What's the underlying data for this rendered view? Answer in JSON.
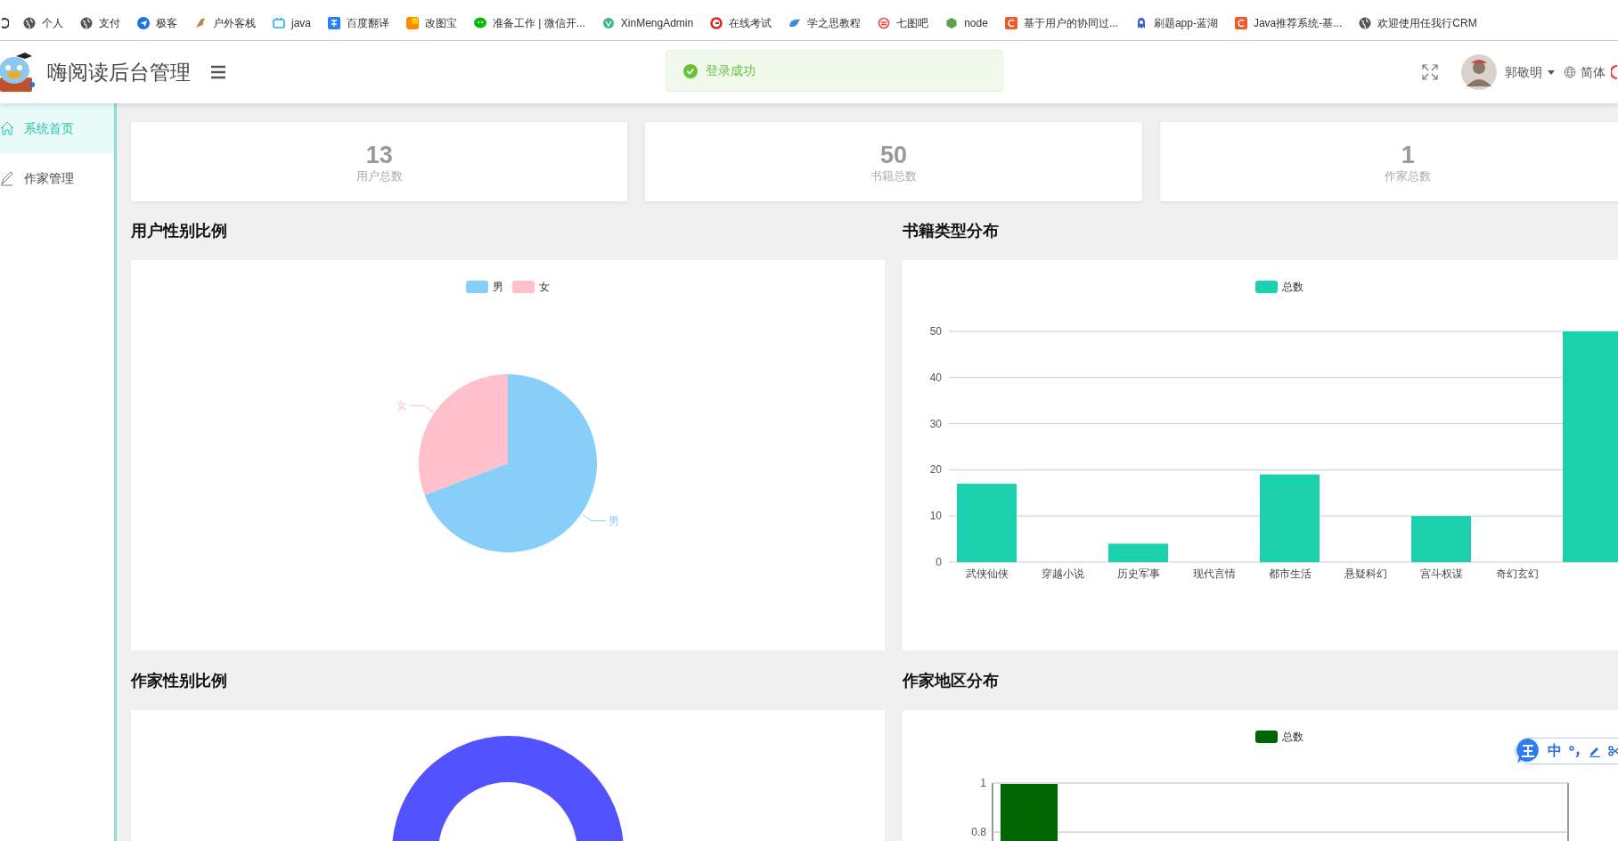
{
  "bookmarks": [
    {
      "label": "个人"
    },
    {
      "label": "支付"
    },
    {
      "label": "极客"
    },
    {
      "label": "户外客栈"
    },
    {
      "label": "java"
    },
    {
      "label": "百度翻译"
    },
    {
      "label": "改图宝"
    },
    {
      "label": "准备工作 | 微信开..."
    },
    {
      "label": "XinMengAdmin"
    },
    {
      "label": "在线考试"
    },
    {
      "label": "学之思教程"
    },
    {
      "label": "七图吧"
    },
    {
      "label": "node"
    },
    {
      "label": "基于用户的协同过..."
    },
    {
      "label": "刷题app-蓝湖"
    },
    {
      "label": "Java推荐系统-基..."
    },
    {
      "label": "欢迎使用任我行CRM"
    }
  ],
  "header": {
    "title": "嗨阅读后台管理",
    "user": "郭敬明",
    "language": "简体"
  },
  "toast": {
    "message": "登录成功"
  },
  "sidebar": {
    "items": [
      {
        "label": "系统首页",
        "selected": true
      },
      {
        "label": "作家管理",
        "selected": false
      }
    ]
  },
  "stats": [
    {
      "value": "13",
      "label": "用户总数"
    },
    {
      "value": "50",
      "label": "书籍总数"
    },
    {
      "value": "1",
      "label": "作家总数"
    }
  ],
  "panels": [
    {
      "title": "用户性别比例",
      "legend": [
        {
          "label": "男",
          "color": "#87cefa"
        },
        {
          "label": "女",
          "color": "#ffc0cb"
        }
      ],
      "chart_data": {
        "type": "pie",
        "categories": [
          "男",
          "女"
        ],
        "values": [
          69.2,
          30.8
        ]
      }
    },
    {
      "title": "书籍类型分布",
      "chart_data": {
        "type": "bar",
        "categories": [
          "武侠仙侠",
          "穿越小说",
          "历史军事",
          "现代言情",
          "都市生活",
          "悬疑科幻",
          "宫斗权谋",
          "奇幻玄幻",
          null
        ],
        "series": [
          {
            "name": "总数",
            "color": "#1bd1ad",
            "values": [
              17,
              0,
              4,
              0,
              19,
              0,
              10,
              0,
              50
            ]
          }
        ],
        "ylim": [
          0,
          50
        ],
        "yticks": [
          0,
          10,
          20,
          30,
          40,
          50
        ],
        "grid": true
      }
    },
    {
      "title": "作家性别比例",
      "kind": "donut"
    },
    {
      "title": "作家地区分布",
      "kind": "bar_cut",
      "legend": [
        {
          "label": "总数",
          "color": "#006400"
        }
      ],
      "axis_labels": [
        "1",
        "0.8"
      ]
    }
  ],
  "ime_toolbar": {
    "mode": "中"
  }
}
